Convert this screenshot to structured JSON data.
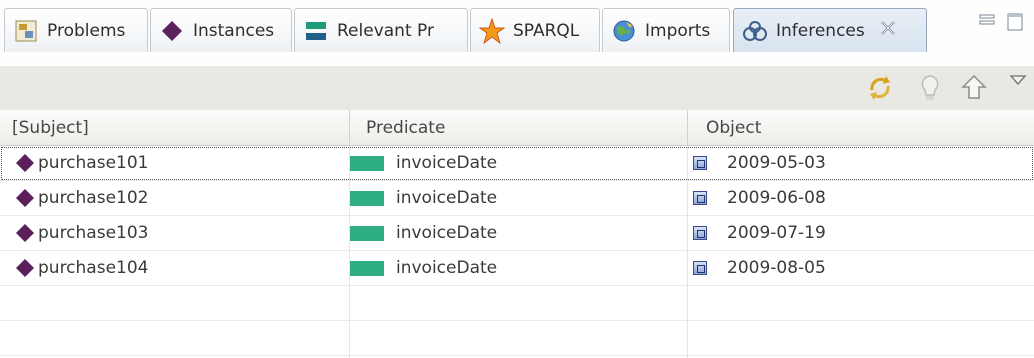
{
  "tabs": [
    {
      "label": "Problems",
      "icon": "problems-icon"
    },
    {
      "label": "Instances",
      "icon": "instances-diamond-icon"
    },
    {
      "label": "Relevant Pr",
      "icon": "relevant-properties-icon"
    },
    {
      "label": "SPARQL",
      "icon": "sparql-star-icon"
    },
    {
      "label": "Imports",
      "icon": "imports-globe-icon"
    },
    {
      "label": "Inferences",
      "icon": "inferences-icon",
      "active": true
    }
  ],
  "table": {
    "columns": [
      "[Subject]",
      "Predicate",
      "Object"
    ],
    "rows": [
      {
        "subject": "purchase101",
        "predicate": "invoiceDate",
        "object": "2009-05-03"
      },
      {
        "subject": "purchase102",
        "predicate": "invoiceDate",
        "object": "2009-06-08"
      },
      {
        "subject": "purchase103",
        "predicate": "invoiceDate",
        "object": "2009-07-19"
      },
      {
        "subject": "purchase104",
        "predicate": "invoiceDate",
        "object": "2009-08-05"
      }
    ]
  },
  "colors": {
    "instance_diamond": "#5b1f5c",
    "property_green": "#2fae86",
    "active_tab": "#d8e3ef"
  }
}
